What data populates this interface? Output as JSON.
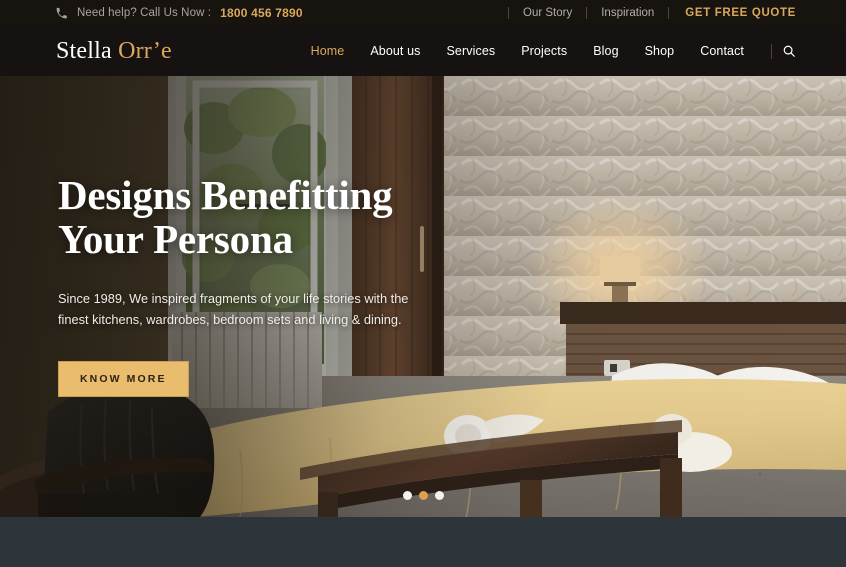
{
  "topbar": {
    "phone_icon": "phone-icon",
    "help_text": "Need help? Call Us Now :",
    "phone_number": "1800 456 7890",
    "links": [
      {
        "label": "Our Story"
      },
      {
        "label": "Inspiration"
      }
    ],
    "quote_label": "GET FREE QUOTE",
    "quote_color": "#d9a85b"
  },
  "header": {
    "logo_first": "Stella",
    "logo_second": "Orr’e",
    "logo_first_color": "#ffffff",
    "logo_second_color": "#d9a85b",
    "nav": [
      {
        "label": "Home",
        "active": true
      },
      {
        "label": "About us",
        "active": false
      },
      {
        "label": "Services",
        "active": false
      },
      {
        "label": "Projects",
        "active": false
      },
      {
        "label": "Blog",
        "active": false
      },
      {
        "label": "Shop",
        "active": false
      },
      {
        "label": "Contact",
        "active": false
      }
    ],
    "search_icon": "search-icon",
    "active_color": "#d9a85b"
  },
  "hero": {
    "title_line1": "Designs Benefitting",
    "title_line2": "Your Persona",
    "subtitle_line1": "Since 1989, We inspired fragments of your life stories with the finest",
    "subtitle_line2": "kitchens, wardrobes, bedroom sets and living & dining.",
    "cta_label": "KNOW MORE",
    "cta_bg": "#e9bd6d",
    "image_alt": "Hotel bedroom with wooden bed, cream bedspread, rolled towels, leather armchair and open window",
    "slider_dots": [
      {
        "active": false
      },
      {
        "active": true
      },
      {
        "active": false
      }
    ],
    "dot_active_color": "#d9a24f"
  },
  "below_section": {
    "background": "#2e353a"
  }
}
